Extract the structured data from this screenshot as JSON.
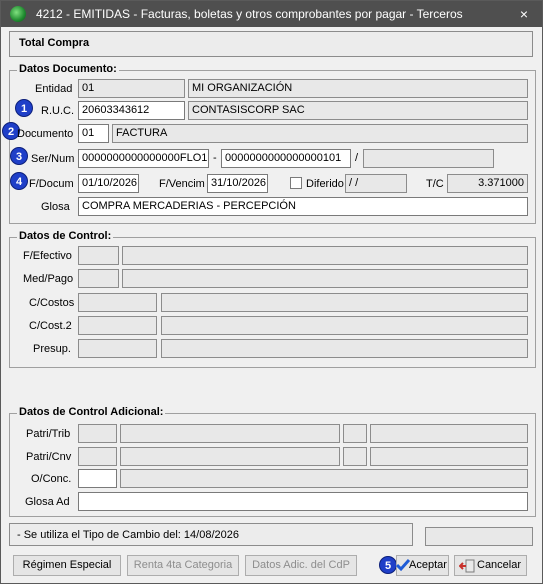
{
  "window": {
    "title": "4212 - EMITIDAS - Facturas, boletas y otros comprobantes por pagar - Terceros",
    "close_glyph": "×"
  },
  "header_box": {
    "text": "Total Compra"
  },
  "datos_documento": {
    "title": "Datos Documento:",
    "entidad": {
      "label": "Entidad",
      "code": "01",
      "name": "MI ORGANIZACIÓN"
    },
    "ruc": {
      "label": "R.U.C.",
      "value": "20603343612",
      "name": "CONTASISCORP SAC"
    },
    "documento": {
      "label": "Documento",
      "code": "01",
      "name": "FACTURA"
    },
    "sernum": {
      "label": "Ser/Num",
      "serie": "0000000000000000FLO1",
      "sep1": "-",
      "numero": "0000000000000000101",
      "sep2": "/",
      "extra": ""
    },
    "fechas": {
      "fdocum_label": "F/Docum",
      "fdocum": "01/10/2026",
      "fvencim_label": "F/Vencim",
      "fvencim": "31/10/2026",
      "diferido_label": "Diferido",
      "diferido_value": " /  /",
      "tc_label": "T/C",
      "tc_value": "3.371000"
    },
    "glosa": {
      "label": "Glosa",
      "value": "COMPRA MERCADERIAS - PERCEPCIÓN"
    }
  },
  "datos_control": {
    "title": "Datos de Control:",
    "fefectivo": "F/Efectivo",
    "medpago": "Med/Pago",
    "ccostos": "C/Costos",
    "ccost2": "C/Cost.2",
    "presup": "Presup."
  },
  "datos_control_adicional": {
    "title": "Datos de Control Adicional:",
    "patritrib": "Patri/Trib",
    "patricnv": "Patri/Cnv",
    "oconc": "O/Conc.",
    "glosa_ad": "Glosa Ad"
  },
  "status": {
    "text": "- Se utiliza el Tipo de Cambio del: 14/08/2026"
  },
  "badges": [
    "1",
    "2",
    "3",
    "4",
    "5"
  ],
  "buttons": {
    "regimen": "Régimen Especial",
    "renta": "Renta 4ta Categoria",
    "datos_adic": "Datos Adic. del CdP",
    "aceptar": "Aceptar",
    "cancelar": "Cancelar"
  },
  "colors": {
    "titlebar": "#4f4f4f",
    "badge": "#1f3fc8",
    "accept_check": "#1e5bd6",
    "cancel_icon": "#c8302a"
  }
}
